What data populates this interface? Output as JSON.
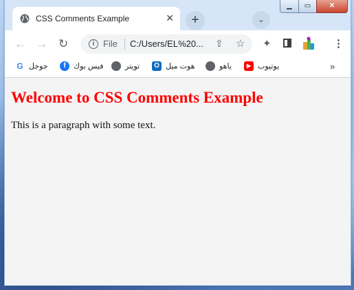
{
  "window_controls": {
    "minimize": "▁",
    "maximize": "▭",
    "close": "✕"
  },
  "tab": {
    "title": "CSS Comments Example",
    "close": "✕"
  },
  "new_tab": "+",
  "tab_search": "⌄",
  "nav": {
    "back": "←",
    "forward": "→",
    "reload": "↻"
  },
  "address": {
    "scheme": "File",
    "url": "C:/Users/EL%20...",
    "share": "⇪",
    "bookmark": "☆"
  },
  "toolbar_icons": {
    "extensions": "✦",
    "menu": "⋮"
  },
  "bookmarks": {
    "items": [
      {
        "label": "جوجل",
        "icon": "google-icon",
        "color": "#4285f4"
      },
      {
        "label": "فيس بوك",
        "icon": "facebook-icon",
        "color": "#1877f2"
      },
      {
        "label": "تويتر",
        "icon": "globe-icon",
        "color": "#5f6368"
      },
      {
        "label": "هوت ميل",
        "icon": "outlook-icon",
        "color": "#0f6cbd"
      },
      {
        "label": "ياهو",
        "icon": "globe-icon",
        "color": "#5f6368"
      },
      {
        "label": "يوتيوب",
        "icon": "youtube-icon",
        "color": "#ff0000"
      }
    ],
    "more": "»"
  },
  "page": {
    "heading": "Welcome to CSS Comments Example",
    "paragraph": "This is a paragraph with some text.",
    "heading_color": "#ff0000"
  }
}
